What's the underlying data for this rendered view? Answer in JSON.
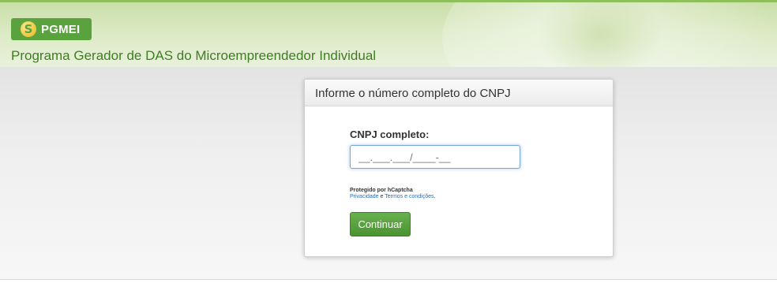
{
  "header": {
    "logo_letter": "S",
    "logo_text": "PGMEI",
    "app_title": "Programa Gerador de DAS do Microempreendedor Individual",
    "accent_color": "#5aa23e"
  },
  "form": {
    "title": "Informe o número completo do CNPJ",
    "cnpj_label": "CNPJ completo:",
    "cnpj_placeholder": "__.___.___/____-__",
    "cnpj_value": "",
    "captcha_protected": "Protegido por hCaptcha",
    "captcha_privacy": "Privacidade",
    "captcha_and": "e",
    "captcha_terms": "Termos e condições",
    "captcha_period": ".",
    "submit_label": "Continuar"
  }
}
